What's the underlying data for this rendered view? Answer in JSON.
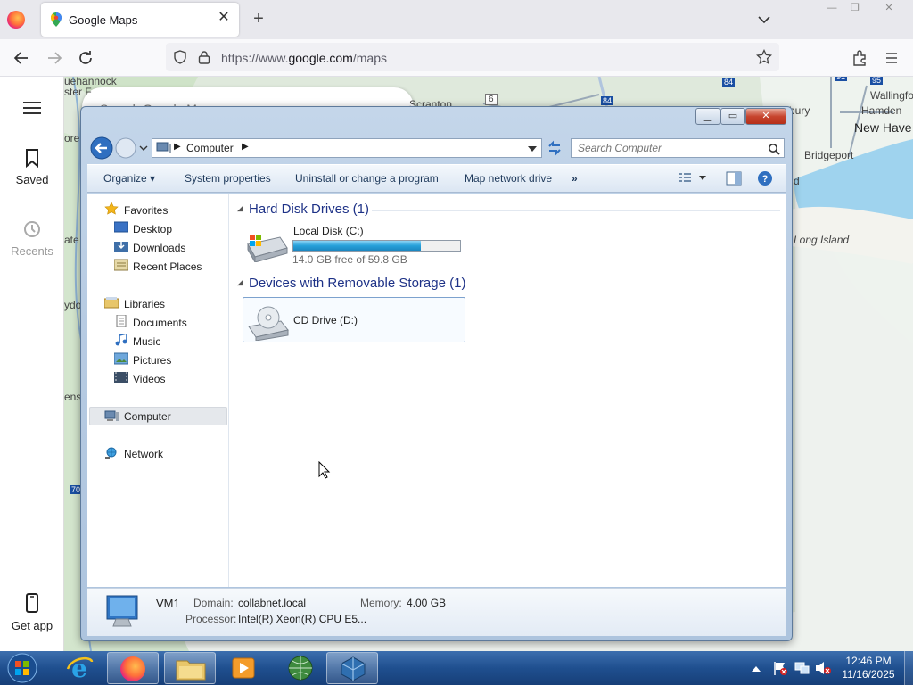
{
  "browser": {
    "tab_title": "Google Maps",
    "url_prefix": "https://www.",
    "url_host": "google.com",
    "url_path": "/maps"
  },
  "maps_sidebar": {
    "menu_icon": "hamburger-icon",
    "saved_label": "Saved",
    "recents_label": "Recents",
    "get_app_label": "Get app",
    "search_placeholder": "Search Google Maps"
  },
  "map_labels": {
    "scranton": "Scranton",
    "wallingford": "Wallingfo",
    "hamden": "Hamden",
    "new_haven": "New Have",
    "bridgeport": "Bridgeport",
    "long_island": "Long Island",
    "bury": "bury",
    "left_1": "uehannock",
    "left_2": "ster F",
    "left_3": "ore",
    "left_4": "ate",
    "left_5": "ydor",
    "left_6": "ens",
    "route_6": "6",
    "route_84": "84",
    "route_84b": "84",
    "route_91": "91",
    "route_95": "95",
    "route_70": "70",
    "d": "d"
  },
  "explorer": {
    "address_crumb": "Computer",
    "search_placeholder": "Search Computer",
    "commands": {
      "organize": "Organize",
      "system_properties": "System properties",
      "uninstall": "Uninstall or change a program",
      "map_drive": "Map network drive",
      "more": "»"
    },
    "nav": {
      "favorites": "Favorites",
      "desktop": "Desktop",
      "downloads": "Downloads",
      "recent_places": "Recent Places",
      "libraries": "Libraries",
      "documents": "Documents",
      "music": "Music",
      "pictures": "Pictures",
      "videos": "Videos",
      "computer": "Computer",
      "network": "Network"
    },
    "groups": {
      "hard_disk": "Hard Disk Drives (1)",
      "removable": "Devices with Removable Storage (1)"
    },
    "drives": {
      "local_name": "Local Disk (C:)",
      "local_free": "14.0 GB free of 59.8 GB",
      "local_used_fraction": 0.766,
      "cd_name": "CD Drive (D:)"
    },
    "details": {
      "name": "VM1",
      "domain_label": "Domain:",
      "domain_value": "collabnet.local",
      "memory_label": "Memory:",
      "memory_value": "4.00 GB",
      "processor_label": "Processor:",
      "processor_value": "Intel(R) Xeon(R) CPU E5..."
    }
  },
  "taskbar": {
    "time": "12:46 PM",
    "date": "11/16/2025",
    "apps": [
      "start-orb",
      "internet-explorer",
      "firefox",
      "windows-explorer",
      "media-player",
      "network-app",
      "virtualbox"
    ]
  },
  "colors": {
    "group_header": "#1e3287",
    "disk_bar": "#26a0da",
    "taskbar": "#1f4f8f"
  }
}
